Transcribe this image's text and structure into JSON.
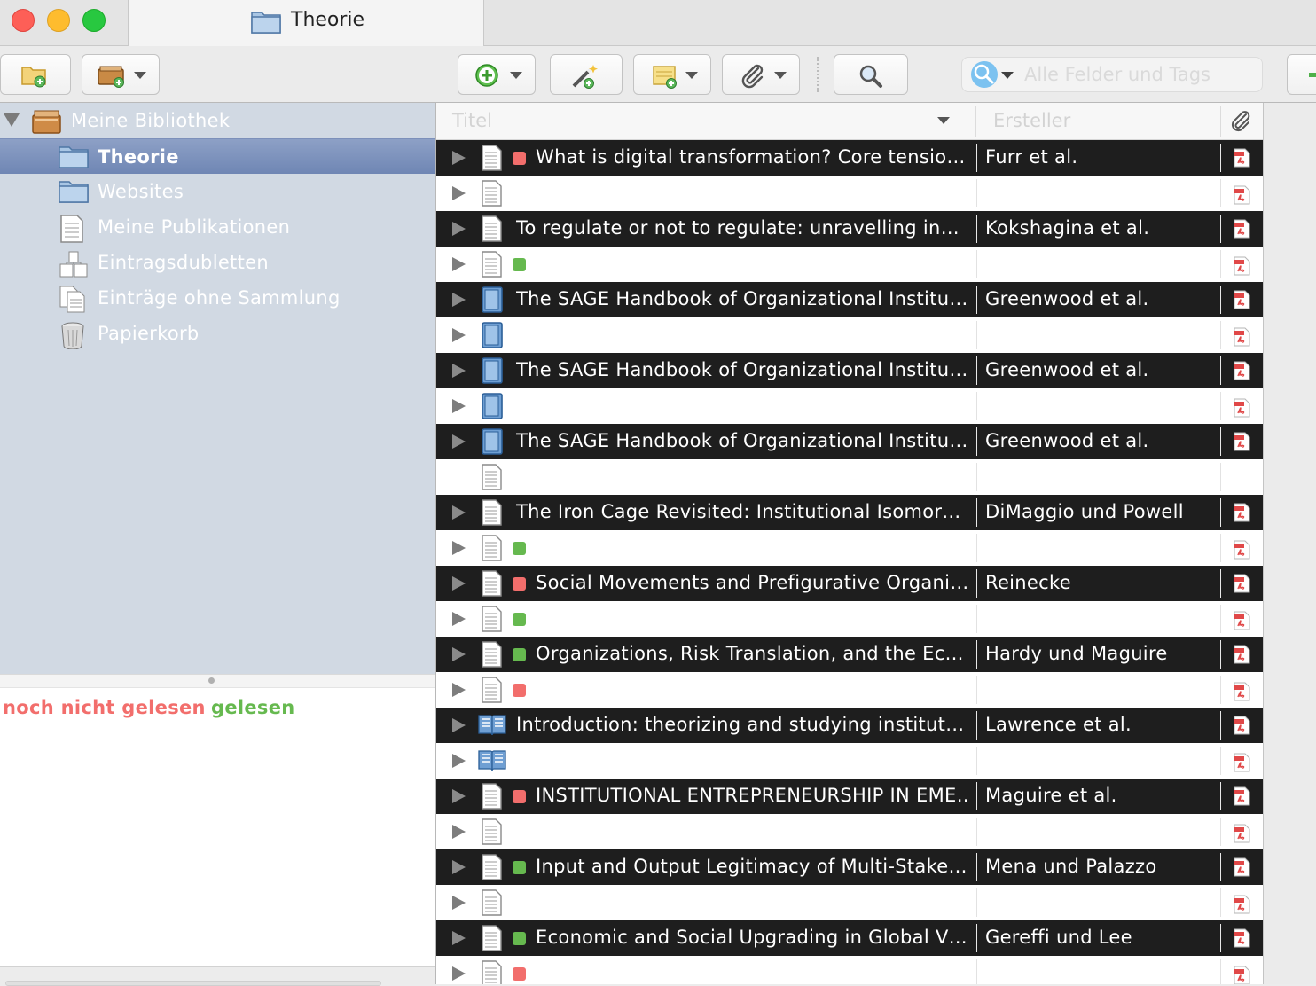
{
  "window": {
    "tab_title": "Theorie"
  },
  "toolbar": {
    "search_placeholder": "Alle Felder und Tags"
  },
  "library": {
    "label": "Meine Bibliothek",
    "collections": [
      {
        "label": "Theorie",
        "icon": "folder-icon",
        "selected": true
      },
      {
        "label": "Websites",
        "icon": "folder-icon",
        "selected": false
      },
      {
        "label": "Meine Publikationen",
        "icon": "document-icon",
        "selected": false
      },
      {
        "label": "Eintragsdubletten",
        "icon": "duplicates-icon",
        "selected": false
      },
      {
        "label": "Einträge ohne Sammlung",
        "icon": "unfiled-icon",
        "selected": false
      },
      {
        "label": "Papierkorb",
        "icon": "trash-icon",
        "selected": false
      }
    ]
  },
  "tags": {
    "unread": "noch nicht gelesen",
    "unread_color": "#f26e6c",
    "read": "gelesen",
    "read_color": "#66b94f"
  },
  "columns": {
    "title": "Titel",
    "creator": "Ersteller"
  },
  "rows": [
    {
      "type": "document",
      "tag": "red",
      "title": "What is digital transformation? Core tensio…",
      "creator": "Furr et al.",
      "dark": true
    },
    {
      "type": "document",
      "tag": "",
      "title": "",
      "creator": "",
      "dark": false
    },
    {
      "type": "document",
      "tag": "",
      "title": "To regulate or not to regulate: unravelling in…",
      "creator": "Kokshagina et al.",
      "dark": true
    },
    {
      "type": "document",
      "tag": "green",
      "title": "",
      "creator": "",
      "dark": false
    },
    {
      "type": "book",
      "tag": "",
      "title": "The SAGE Handbook of Organizational Institu…",
      "creator": "Greenwood et al.",
      "dark": true
    },
    {
      "type": "book",
      "tag": "",
      "title": "",
      "creator": "",
      "dark": false
    },
    {
      "type": "book",
      "tag": "",
      "title": "The SAGE Handbook of Organizational Institu…",
      "creator": "Greenwood et al.",
      "dark": true
    },
    {
      "type": "book",
      "tag": "",
      "title": "",
      "creator": "",
      "dark": false
    },
    {
      "type": "book",
      "tag": "",
      "title": "The SAGE Handbook of Organizational Institu…",
      "creator": "Greenwood et al.",
      "dark": true
    },
    {
      "type": "document",
      "tag": "",
      "title": "",
      "creator": "",
      "dark": false,
      "no_twisty": true,
      "no_pdf": true
    },
    {
      "type": "document",
      "tag": "",
      "title": "The Iron Cage Revisited: Institutional Isomor…",
      "creator": "DiMaggio und Powell",
      "dark": true
    },
    {
      "type": "document",
      "tag": "green",
      "title": "",
      "creator": "",
      "dark": false
    },
    {
      "type": "document",
      "tag": "red",
      "title": "Social Movements and Prefigurative Organi…",
      "creator": "Reinecke",
      "dark": true
    },
    {
      "type": "document",
      "tag": "green",
      "title": "",
      "creator": "",
      "dark": false
    },
    {
      "type": "document",
      "tag": "green",
      "title": "Organizations, Risk Translation, and the Ec…",
      "creator": "Hardy und Maguire",
      "dark": true
    },
    {
      "type": "document",
      "tag": "red",
      "title": "",
      "creator": "",
      "dark": false
    },
    {
      "type": "booksection",
      "tag": "",
      "title": "Introduction: theorizing and studying institut…",
      "creator": "Lawrence et al.",
      "dark": true
    },
    {
      "type": "booksection",
      "tag": "",
      "title": "",
      "creator": "",
      "dark": false
    },
    {
      "type": "document",
      "tag": "red",
      "title": "INSTITUTIONAL ENTREPRENEURSHIP IN EME…",
      "creator": "Maguire et al.",
      "dark": true
    },
    {
      "type": "document",
      "tag": "",
      "title": "",
      "creator": "",
      "dark": false
    },
    {
      "type": "document",
      "tag": "green",
      "title": "Input and Output Legitimacy of Multi-Stake…",
      "creator": "Mena und Palazzo",
      "dark": true
    },
    {
      "type": "document",
      "tag": "",
      "title": "",
      "creator": "",
      "dark": false
    },
    {
      "type": "document",
      "tag": "green",
      "title": "Economic and Social Upgrading in Global V…",
      "creator": "Gereffi und Lee",
      "dark": true
    },
    {
      "type": "document",
      "tag": "red",
      "title": "",
      "creator": "",
      "dark": false
    }
  ]
}
